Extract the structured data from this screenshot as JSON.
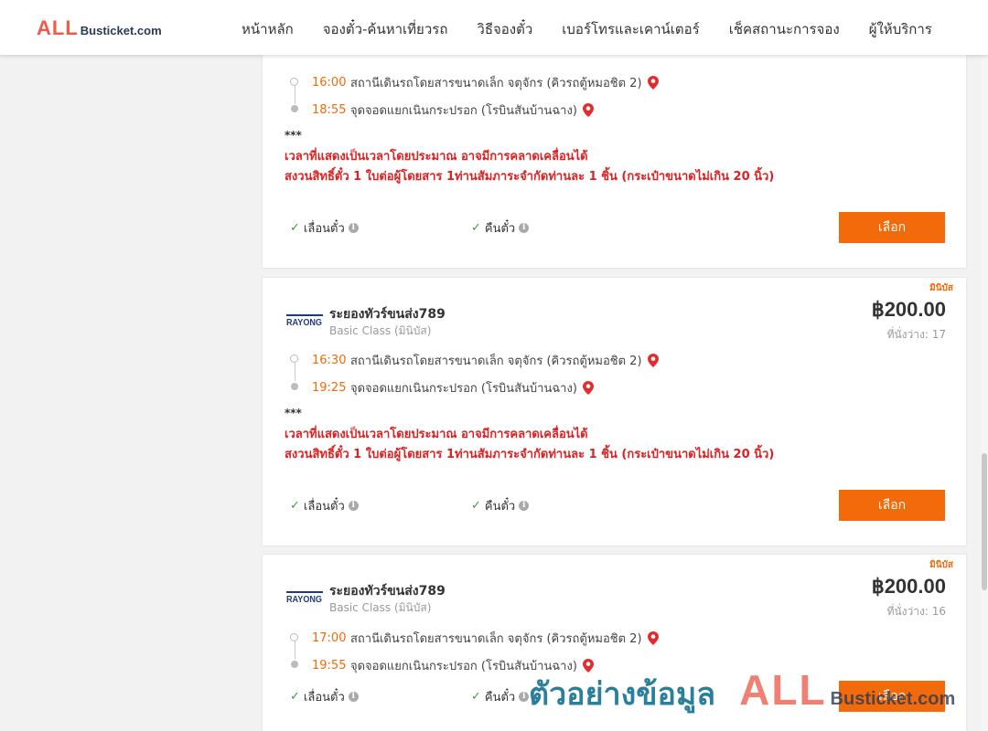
{
  "header": {
    "logo_all": "ALL",
    "logo_rest": "Busticket.com",
    "nav": [
      "หน้าหลัก",
      "จองตั๋ว-ค้นหาเที่ยวรถ",
      "วิธีจองตั๋ว",
      "เบอร์โทรและเคาน์เตอร์",
      "เช็คสถานะการจอง",
      "ผู้ให้บริการ"
    ]
  },
  "cards": [
    {
      "departure_time": "16:00",
      "departure_place": "สถานีเดินรถโดยสารขนาดเล็ก จตุจักร (คิวรถตู้หมอชิต 2)",
      "arrival_time": "18:55",
      "arrival_place": "จุดจอดแยกเนินกระปรอก (โรบินสันบ้านฉาง)",
      "note_stars": "***",
      "note_line1": "เวลาที่แสดงเป็นเวลาโดยประมาณ อาจมีการคลาดเคลื่อนได้",
      "note_line2": "สงวนสิทธิ์ตั๋ว 1 ใบต่อผู้โดยสาร 1ท่านสัมภาระจำกัดท่านละ 1 ชิ้น (กระเป๋าขนาดไม่เกิน 20 นิ้ว)",
      "policy_change": "เลื่อนตั๋ว",
      "policy_refund": "คืนตั๋ว",
      "select_label": "เลือก"
    },
    {
      "badge": "มินิบัส",
      "operator_logo": "RAYONG",
      "operator_name": "ระยองทัวร์ขนส่ง789",
      "class_label": "Basic Class (มินิบัส)",
      "price": "฿200.00",
      "seats": "ที่นั่งว่าง: 17",
      "departure_time": "16:30",
      "departure_place": "สถานีเดินรถโดยสารขนาดเล็ก จตุจักร (คิวรถตู้หมอชิต 2)",
      "arrival_time": "19:25",
      "arrival_place": "จุดจอดแยกเนินกระปรอก (โรบินสันบ้านฉาง)",
      "note_stars": "***",
      "note_line1": "เวลาที่แสดงเป็นเวลาโดยประมาณ อาจมีการคลาดเคลื่อนได้",
      "note_line2": "สงวนสิทธิ์ตั๋ว 1 ใบต่อผู้โดยสาร 1ท่านสัมภาระจำกัดท่านละ 1 ชิ้น (กระเป๋าขนาดไม่เกิน 20 นิ้ว)",
      "policy_change": "เลื่อนตั๋ว",
      "policy_refund": "คืนตั๋ว",
      "select_label": "เลือก"
    },
    {
      "badge": "มินิบัส",
      "operator_logo": "RAYONG",
      "operator_name": "ระยองทัวร์ขนส่ง789",
      "class_label": "Basic Class (มินิบัส)",
      "price": "฿200.00",
      "seats": "ที่นั่งว่าง: 16",
      "departure_time": "17:00",
      "departure_place": "สถานีเดินรถโดยสารขนาดเล็ก จตุจักร (คิวรถตู้หมอชิต 2)",
      "arrival_time": "19:55",
      "arrival_place": "จุดจอดแยกเนินกระปรอก (โรบินสันบ้านฉาง)",
      "policy_change": "เลื่อนตั๋ว",
      "policy_refund": "คืนตั๋ว",
      "select_label": "เลือก"
    }
  ],
  "watermark": {
    "text": "ตัวอย่างข้อมูล",
    "logo_all": "ALL",
    "logo_rest": "Busticket.com"
  },
  "colors": {
    "accent": "#f26a0a",
    "warning_text": "#e02020",
    "check": "#3a9d3a",
    "logo_red": "#f05a4a",
    "logo_navy": "#2b3a57"
  },
  "icons": [
    "map-pin-icon",
    "check-icon",
    "info-icon",
    "rayong-logo"
  ]
}
